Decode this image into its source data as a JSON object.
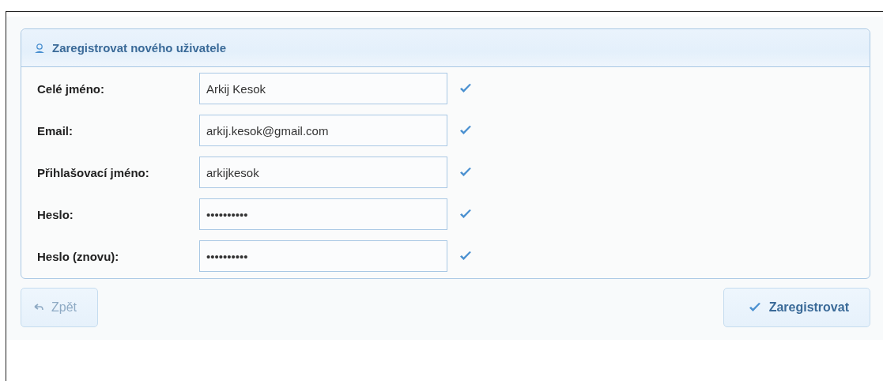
{
  "panel": {
    "title": "Zaregistrovat nového uživatele"
  },
  "fields": [
    {
      "label": "Celé jméno:",
      "value": "Arkij Kesok",
      "valid": true
    },
    {
      "label": "Email:",
      "value": "arkij.kesok@gmail.com",
      "valid": true
    },
    {
      "label": "Přihlašovací jméno:",
      "value": "arkijkesok",
      "valid": true
    },
    {
      "label": "Heslo:",
      "value": "••••••••••",
      "valid": true
    },
    {
      "label": "Heslo (znovu):",
      "value": "••••••••••",
      "valid": true
    }
  ],
  "buttons": [
    {
      "kind": "back",
      "label": "Zpět",
      "disabled": true
    },
    {
      "kind": "submit",
      "label": "Zaregistrovat",
      "disabled": false
    }
  ]
}
